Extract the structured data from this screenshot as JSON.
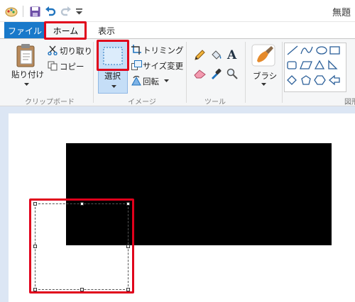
{
  "title_bar": {
    "title": "無題",
    "quick_access": [
      "paint-app-icon",
      "save-icon",
      "undo-icon",
      "redo-icon",
      "customize-qat-icon"
    ]
  },
  "tabs": [
    {
      "label": "ファイル",
      "active": false
    },
    {
      "label": "ホーム",
      "active": true
    },
    {
      "label": "表示",
      "active": false
    }
  ],
  "ribbon": {
    "clipboard": {
      "paste_label": "貼り付け",
      "cut_label": "切り取り",
      "copy_label": "コピー",
      "group_label": "クリップボード"
    },
    "image": {
      "select_label": "選択",
      "crop_label": "トリミング",
      "resize_label": "サイズ変更",
      "rotate_label": "回転",
      "group_label": "イメージ"
    },
    "tools": {
      "group_label": "ツール",
      "items": [
        "pencil-icon",
        "fill-icon",
        "text-icon",
        "eraser-icon",
        "color-picker-icon",
        "magnifier-icon"
      ]
    },
    "brushes": {
      "label": "ブラシ"
    },
    "shapes": {
      "group_label": "図形"
    }
  },
  "colors": {
    "file_tab": "#1979ca",
    "highlight": "#e0001b",
    "canvas_bg": "#dce6f4",
    "select_active": "#c5def7"
  }
}
